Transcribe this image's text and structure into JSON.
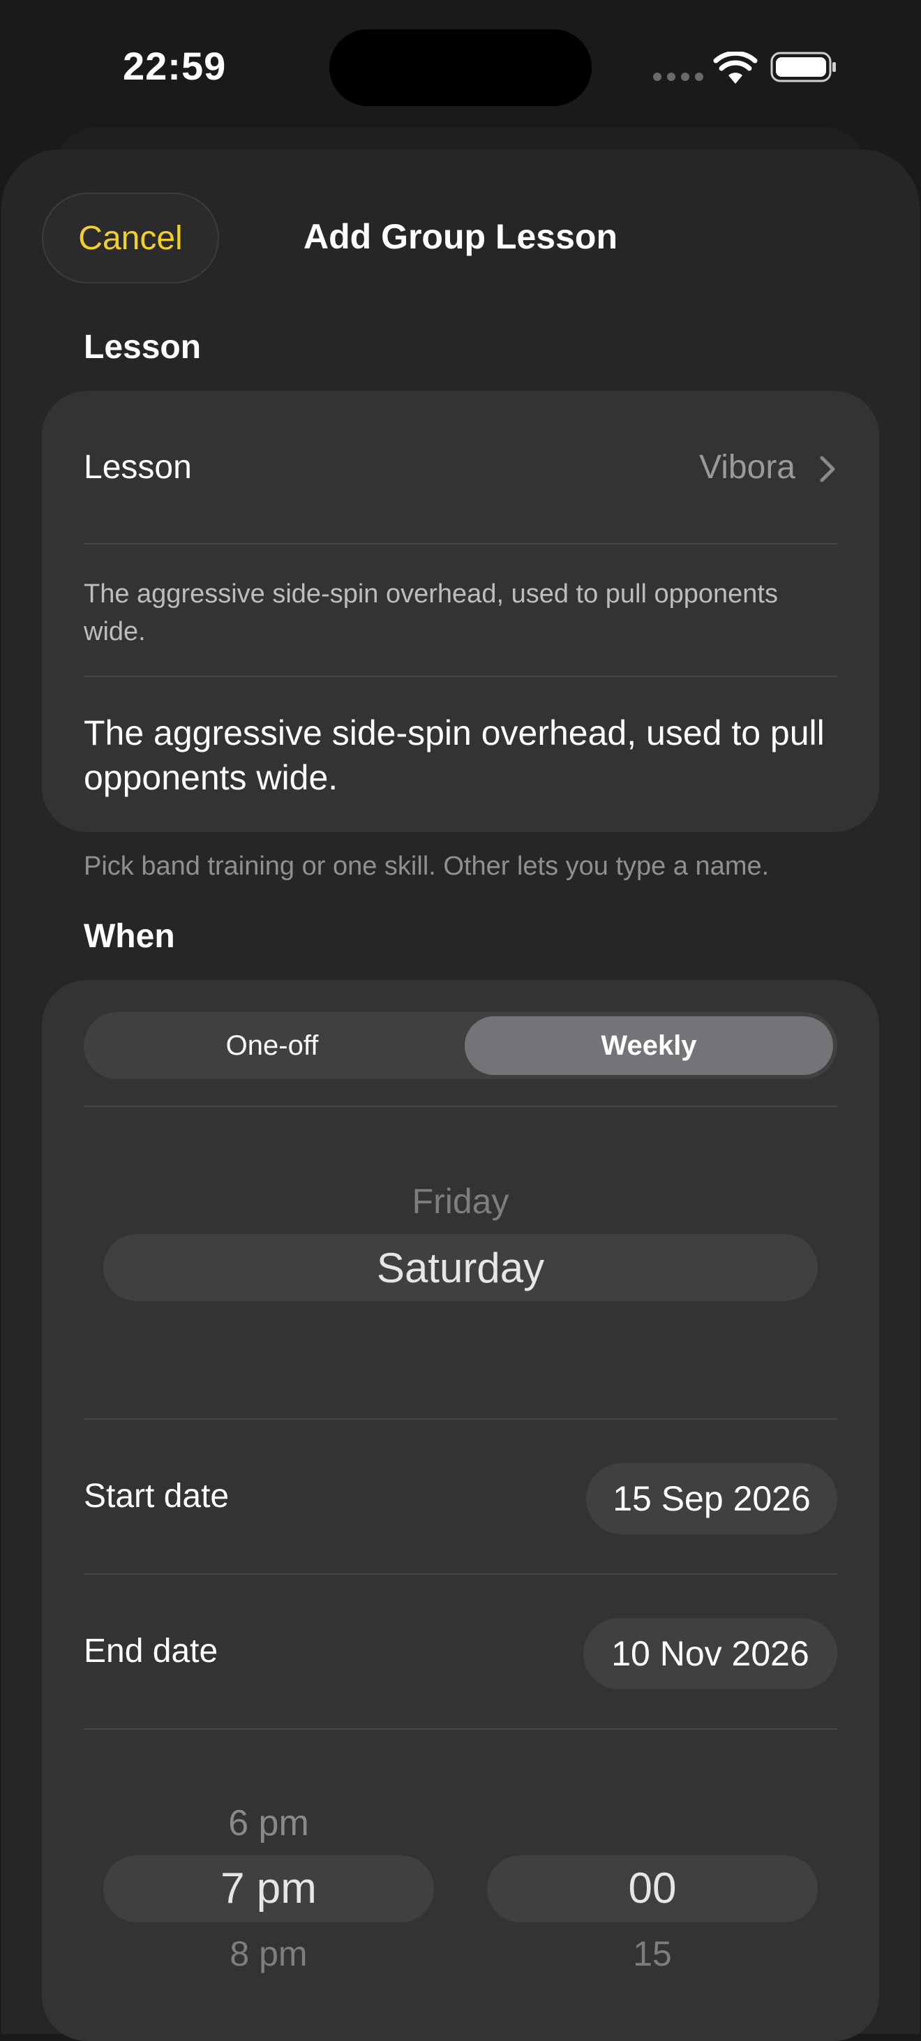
{
  "status_bar": {
    "time": "22:59"
  },
  "nav": {
    "cancel_label": "Cancel",
    "title": "Add Group Lesson"
  },
  "lesson_section": {
    "header": "Lesson",
    "row_label": "Lesson",
    "row_value": "Vibora",
    "description_small": "The aggressive side-spin overhead, used to pull opponents wide.",
    "description_large": "The aggressive side-spin overhead, used to pull opponents wide.",
    "footnote": "Pick band training or one skill. Other lets you type a name."
  },
  "when_section": {
    "header": "When",
    "segments": [
      "One-off",
      "Weekly"
    ],
    "selected_segment": "Weekly",
    "day_picker": {
      "above": "Friday",
      "selected": "Saturday"
    },
    "start_date_label": "Start date",
    "start_date_value": "15 Sep 2026",
    "end_date_label": "End date",
    "end_date_value": "10 Nov 2026",
    "hour_picker": {
      "above": "6 pm",
      "selected": "7 pm",
      "below": "8 pm"
    },
    "minute_picker": {
      "selected": "00",
      "below": "15"
    }
  },
  "colors": {
    "accent": "#f2cf2c",
    "background": "#1a1a1a",
    "card": "#333333"
  }
}
